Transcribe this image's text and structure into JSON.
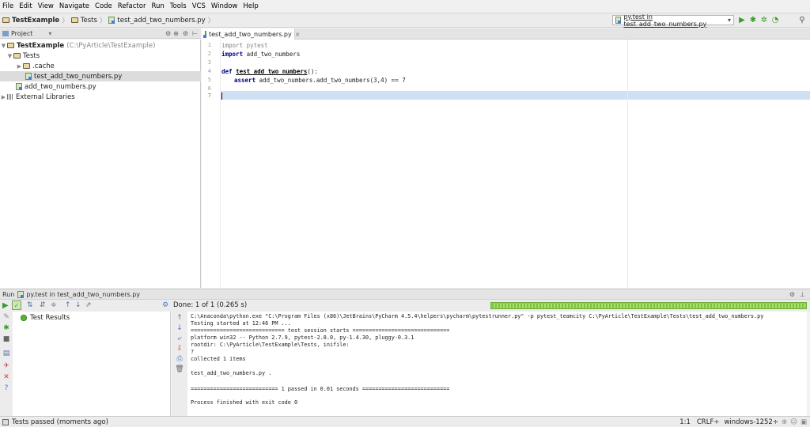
{
  "menu": [
    "File",
    "Edit",
    "View",
    "Navigate",
    "Code",
    "Refactor",
    "Run",
    "Tools",
    "VCS",
    "Window",
    "Help"
  ],
  "breadcrumb": {
    "project": "TestExample",
    "folder": "Tests",
    "file": "test_add_two_numbers.py"
  },
  "run_config": {
    "label": "py.test in test_add_two_numbers.py"
  },
  "project_panel": {
    "title": "Project",
    "tree": [
      {
        "label": "TestExample",
        "path": "(C:\\PyArticle\\TestExample)"
      },
      {
        "label": "Tests"
      },
      {
        "label": ".cache"
      },
      {
        "label": "test_add_two_numbers.py"
      },
      {
        "label": "add_two_numbers.py"
      },
      {
        "label": "External Libraries"
      }
    ]
  },
  "editor": {
    "tab": "test_add_two_numbers.py",
    "tab_close": "×",
    "line_numbers": [
      "1",
      "2",
      "3",
      "4",
      "5",
      "6",
      "7"
    ],
    "lines": [
      {
        "kw": "import",
        "rest": " pytest"
      },
      {
        "kw": "import",
        "rest": " add_two_numbers"
      },
      {
        "kw": "",
        "rest": ""
      },
      {
        "kw": "def",
        "fn": "test_add_two_numbers",
        "rest": "():"
      },
      {
        "kw": "assert",
        "rest": " add_two_numbers.add_two_numbers(3,4) == 7"
      },
      {
        "kw": "",
        "rest": ""
      },
      {
        "kw": "",
        "rest": ""
      }
    ]
  },
  "run_panel": {
    "title": "Run",
    "config": "py.test in test_add_two_numbers.py",
    "done_text": "Done: 1 of 1  (0.265 s)",
    "progress": 1.0,
    "tree_root": "Test Results",
    "console": [
      "C:\\Anaconda\\python.exe \"C:\\Program Files (x86)\\JetBrains\\PyCharm 4.5.4\\helpers\\pycharm\\pytestrunner.py\" -p pytest_teamcity C:\\PyArticle\\TestExample\\Tests\\test_add_two_numbers.py",
      "Testing started at 12:46 PM ...",
      "============================= test session starts ==============================",
      "platform win32 -- Python 2.7.9, pytest-2.8.0, py-1.4.30, pluggy-0.3.1",
      "rootdir: C:\\PyArticle\\TestExample\\Tests, inifile:",
      "?",
      "collected 1 items",
      "",
      "test_add_two_numbers.py .",
      "",
      "=========================== 1 passed in 0.01 seconds ===========================",
      "",
      "Process finished with exit code 0"
    ]
  },
  "status": {
    "message": "Tests passed (moments ago)",
    "position": "1:1",
    "line_sep": "CRLF÷",
    "encoding": "windows-1252÷"
  },
  "colors": {
    "accent": "#3f7fd0",
    "pass": "#5fb336",
    "keyword": "#000080"
  }
}
